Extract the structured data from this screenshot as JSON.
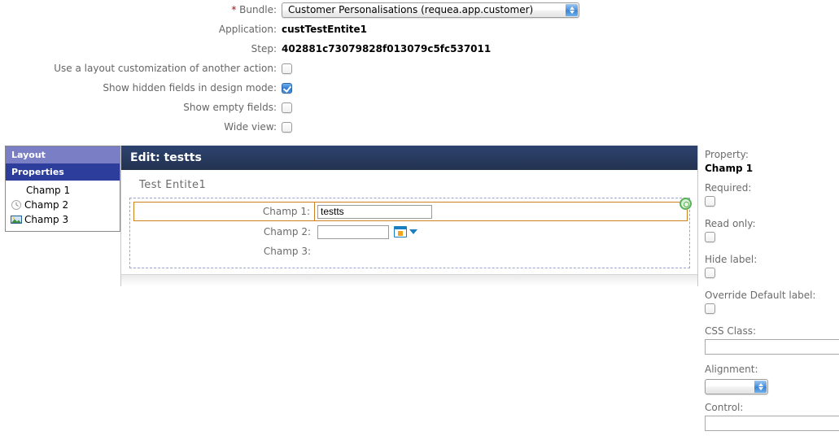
{
  "top_form": {
    "rows": [
      {
        "label": "Bundle:",
        "required": true,
        "type": "select",
        "value": "Customer Personalisations (requea.app.customer)"
      },
      {
        "label": "Application:",
        "required": false,
        "type": "text",
        "value": "custTestEntite1"
      },
      {
        "label": "Step:",
        "required": false,
        "type": "text",
        "value": "402881c73079828f013079c5fc537011"
      },
      {
        "label": "Use a layout customization of another action:",
        "required": false,
        "type": "checkbox",
        "checked": false
      },
      {
        "label": "Show hidden fields in design mode:",
        "required": false,
        "type": "checkbox",
        "checked": true
      },
      {
        "label": "Show empty fields:",
        "required": false,
        "type": "checkbox",
        "checked": false
      },
      {
        "label": "Wide view:",
        "required": false,
        "type": "checkbox",
        "checked": false
      }
    ]
  },
  "left_panel": {
    "tabs": [
      {
        "label": "Layout",
        "active": false
      },
      {
        "label": "Properties",
        "active": true
      }
    ],
    "tree": [
      {
        "label": "Champ 1",
        "icon": "none"
      },
      {
        "label": "Champ 2",
        "icon": "clock-icon"
      },
      {
        "label": "Champ 3",
        "icon": "image-icon"
      }
    ]
  },
  "main_panel": {
    "header_title": "Edit: testts",
    "entity_title": "Test Entite1",
    "fields": [
      {
        "label": "Champ 1:",
        "value": "testts",
        "control": "text",
        "selected": true
      },
      {
        "label": "Champ 2:",
        "value": "",
        "control": "date",
        "selected": false
      },
      {
        "label": "Champ 3:",
        "value": "",
        "control": "none",
        "selected": false
      }
    ],
    "icons": {
      "settings": "gear-icon",
      "calendar": "calendar-icon",
      "calendar_dropdown": "chevron-down-icon"
    }
  },
  "right_panel": {
    "property_label": "Property:",
    "property_value": "Champ 1",
    "required_label": "Required:",
    "required_checked": false,
    "readonly_label": "Read only:",
    "readonly_checked": false,
    "hidelabel_label": "Hide label:",
    "hidelabel_checked": false,
    "override_label": "Override Default label:",
    "override_checked": false,
    "cssclass_label": "CSS Class:",
    "cssclass_value": "",
    "alignment_label": "Alignment:",
    "alignment_value": "",
    "control_label": "Control:",
    "control_value": ""
  },
  "colors": {
    "tab_layout_bg": "#7a7ec4",
    "tab_properties_bg": "#2c3d9c",
    "main_header_bg": "#22324f",
    "selected_field_border": "#cd8221",
    "dashed_border": "#99a4d0",
    "accent_blue": "#3a84d6"
  }
}
